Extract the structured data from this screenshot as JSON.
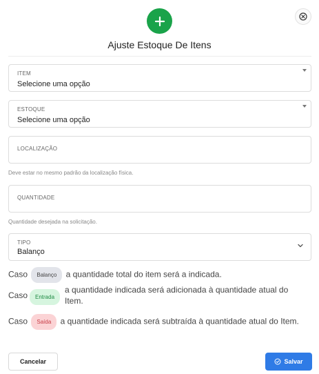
{
  "header": {
    "title": "Ajuste Estoque De Itens",
    "icon": "plus-icon",
    "icon_color": "#1aa34a",
    "close_icon": "close-circle-icon"
  },
  "fields": {
    "item": {
      "label": "ITEM",
      "value": "Selecione uma opção"
    },
    "estoque": {
      "label": "ESTOQUE",
      "value": "Selecione uma opção"
    },
    "localizacao": {
      "label": "LOCALIZAÇÃO",
      "value": "",
      "helper": "Deve estar no mesmo padrão da localização física."
    },
    "quantidade": {
      "label": "QUANTIDADE",
      "value": "",
      "helper": "Quantidade desejada na solicitação."
    },
    "tipo": {
      "label": "TIPO",
      "value": "Balanço"
    }
  },
  "info": {
    "line1": {
      "prefix": "Caso",
      "badge": "Balanço",
      "text": "a quantidade total do item será a indicada."
    },
    "line2": {
      "prefix": "Caso",
      "badge": "Entrada",
      "text_a": "a quantidade indicada será adicionada à quantidade atual do",
      "text_b": "Item."
    },
    "line3": {
      "prefix": "Caso",
      "badge": "Saída",
      "text": "a quantidade indicada será subtraída à quantidade atual do Item."
    }
  },
  "footer": {
    "cancel_label": "Cancelar",
    "save_label": "Salvar",
    "save_color": "#2f7be6"
  }
}
